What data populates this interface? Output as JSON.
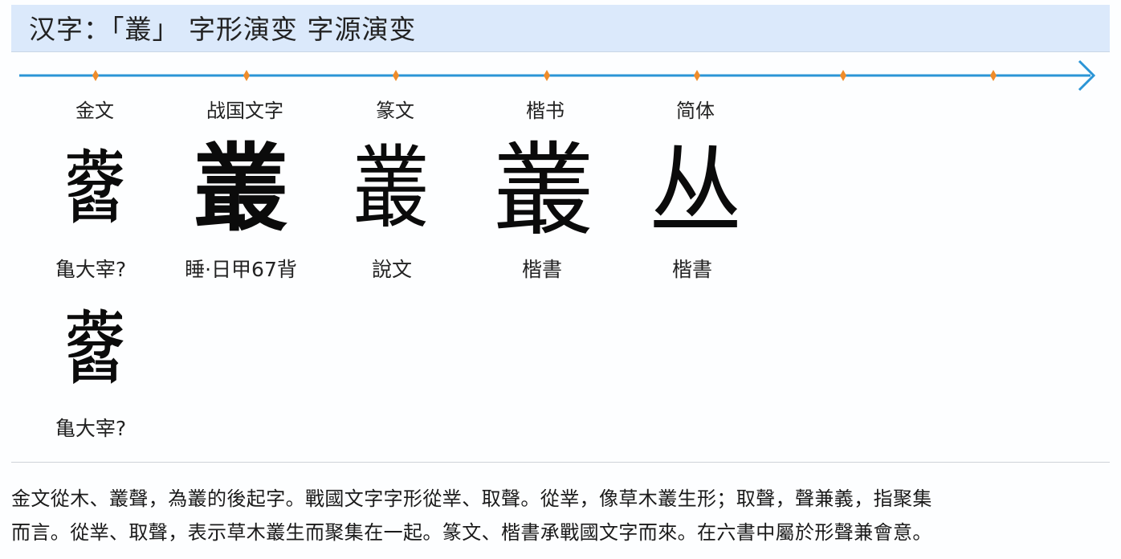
{
  "header": {
    "title": "汉字：「叢」 字形演变 字源演变"
  },
  "timeline": {
    "line_color": "#2b95d6",
    "dot_color": "#f08c2a"
  },
  "stages": [
    {
      "label": "金文",
      "glyph": "𦽜",
      "source": "亀大宰?"
    },
    {
      "label": "战国文字",
      "glyph": "叢",
      "source": "睡·日甲67背"
    },
    {
      "label": "篆文",
      "glyph": "叢",
      "source": "說文"
    },
    {
      "label": "楷书",
      "glyph": "叢",
      "source": "楷書"
    },
    {
      "label": "简体",
      "glyph": "丛",
      "source": "楷書"
    }
  ],
  "extra": {
    "glyph": "𦽜",
    "source": "亀大宰?"
  },
  "description": {
    "line1": "金文從木、叢聲，為叢的後起字。戰國文字字形從丵、取聲。從丵，像草木叢生形；取聲，聲兼義，指聚集",
    "line2": "而言。從丵、取聲，表示草木叢生而聚集在一起。篆文、楷書承戰國文字而來。在六書中屬於形聲兼會意。"
  }
}
